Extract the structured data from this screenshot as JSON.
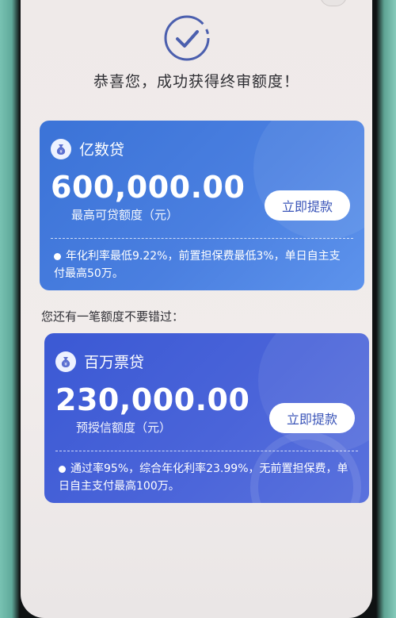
{
  "header": {
    "title": "恭喜您，成功获得终审额度！"
  },
  "icons": {
    "check": "check-circle-icon",
    "bag": "money-bag-icon"
  },
  "colors": {
    "card1": "#4a7fe0",
    "card2": "#4a64d9",
    "button_text": "#3a54b8"
  },
  "card1": {
    "name": "亿数贷",
    "amount": "600,000.00",
    "amount_label": "最高可贷额度（元）",
    "button": "立即提款",
    "desc": "年化利率最低9.22%，前置担保费最低3%，单日自主支付最高50万。"
  },
  "section": {
    "note": "您还有一笔额度不要错过："
  },
  "card2": {
    "name": "百万票贷",
    "amount": "230,000.00",
    "amount_label": "预授信额度（元）",
    "button": "立即提款",
    "desc": "通过率95%，综合年化利率23.99%，无前置担保费，单日自主支付最高100万。"
  }
}
